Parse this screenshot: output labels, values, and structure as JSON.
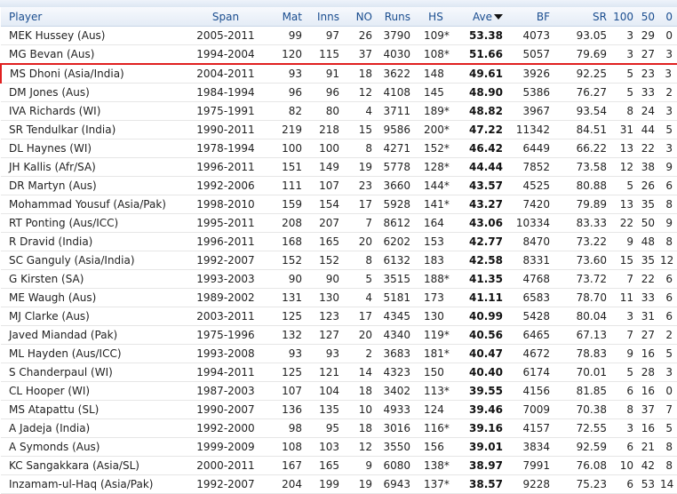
{
  "columns": {
    "player": "Player",
    "span": "Span",
    "mat": "Mat",
    "inns": "Inns",
    "no": "NO",
    "runs": "Runs",
    "hs": "HS",
    "ave": "Ave",
    "bf": "BF",
    "sr": "SR",
    "hundreds": "100",
    "fifties": "50",
    "ducks": "0"
  },
  "rows": [
    {
      "player": "MEK Hussey (Aus)",
      "span": "2005-2011",
      "mat": "99",
      "inns": "97",
      "no": "26",
      "runs": "3790",
      "hs": "109*",
      "ave": "53.38",
      "bf": "4073",
      "sr": "93.05",
      "hundreds": "3",
      "fifties": "29",
      "ducks": "0"
    },
    {
      "player": "MG Bevan (Aus)",
      "span": "1994-2004",
      "mat": "120",
      "inns": "115",
      "no": "37",
      "runs": "4030",
      "hs": "108*",
      "ave": "51.66",
      "bf": "5057",
      "sr": "79.69",
      "hundreds": "3",
      "fifties": "27",
      "ducks": "3"
    },
    {
      "player": "MS Dhoni (Asia/India)",
      "span": "2004-2011",
      "mat": "93",
      "inns": "91",
      "no": "18",
      "runs": "3622",
      "hs": "148",
      "ave": "49.61",
      "bf": "3926",
      "sr": "92.25",
      "hundreds": "5",
      "fifties": "23",
      "ducks": "3"
    },
    {
      "player": "DM Jones (Aus)",
      "span": "1984-1994",
      "mat": "96",
      "inns": "96",
      "no": "12",
      "runs": "4108",
      "hs": "145",
      "ave": "48.90",
      "bf": "5386",
      "sr": "76.27",
      "hundreds": "5",
      "fifties": "33",
      "ducks": "2"
    },
    {
      "player": "IVA Richards (WI)",
      "span": "1975-1991",
      "mat": "82",
      "inns": "80",
      "no": "4",
      "runs": "3711",
      "hs": "189*",
      "ave": "48.82",
      "bf": "3967",
      "sr": "93.54",
      "hundreds": "8",
      "fifties": "24",
      "ducks": "3"
    },
    {
      "player": "SR Tendulkar (India)",
      "span": "1990-2011",
      "mat": "219",
      "inns": "218",
      "no": "15",
      "runs": "9586",
      "hs": "200*",
      "ave": "47.22",
      "bf": "11342",
      "sr": "84.51",
      "hundreds": "31",
      "fifties": "44",
      "ducks": "5"
    },
    {
      "player": "DL Haynes (WI)",
      "span": "1978-1994",
      "mat": "100",
      "inns": "100",
      "no": "8",
      "runs": "4271",
      "hs": "152*",
      "ave": "46.42",
      "bf": "6449",
      "sr": "66.22",
      "hundreds": "13",
      "fifties": "22",
      "ducks": "3"
    },
    {
      "player": "JH Kallis (Afr/SA)",
      "span": "1996-2011",
      "mat": "151",
      "inns": "149",
      "no": "19",
      "runs": "5778",
      "hs": "128*",
      "ave": "44.44",
      "bf": "7852",
      "sr": "73.58",
      "hundreds": "12",
      "fifties": "38",
      "ducks": "9"
    },
    {
      "player": "DR Martyn (Aus)",
      "span": "1992-2006",
      "mat": "111",
      "inns": "107",
      "no": "23",
      "runs": "3660",
      "hs": "144*",
      "ave": "43.57",
      "bf": "4525",
      "sr": "80.88",
      "hundreds": "5",
      "fifties": "26",
      "ducks": "6"
    },
    {
      "player": "Mohammad Yousuf (Asia/Pak)",
      "span": "1998-2010",
      "mat": "159",
      "inns": "154",
      "no": "17",
      "runs": "5928",
      "hs": "141*",
      "ave": "43.27",
      "bf": "7420",
      "sr": "79.89",
      "hundreds": "13",
      "fifties": "35",
      "ducks": "8"
    },
    {
      "player": "RT Ponting (Aus/ICC)",
      "span": "1995-2011",
      "mat": "208",
      "inns": "207",
      "no": "7",
      "runs": "8612",
      "hs": "164",
      "ave": "43.06",
      "bf": "10334",
      "sr": "83.33",
      "hundreds": "22",
      "fifties": "50",
      "ducks": "9"
    },
    {
      "player": "R Dravid (India)",
      "span": "1996-2011",
      "mat": "168",
      "inns": "165",
      "no": "20",
      "runs": "6202",
      "hs": "153",
      "ave": "42.77",
      "bf": "8470",
      "sr": "73.22",
      "hundreds": "9",
      "fifties": "48",
      "ducks": "8"
    },
    {
      "player": "SC Ganguly (Asia/India)",
      "span": "1992-2007",
      "mat": "152",
      "inns": "152",
      "no": "8",
      "runs": "6132",
      "hs": "183",
      "ave": "42.58",
      "bf": "8331",
      "sr": "73.60",
      "hundreds": "15",
      "fifties": "35",
      "ducks": "12"
    },
    {
      "player": "G Kirsten (SA)",
      "span": "1993-2003",
      "mat": "90",
      "inns": "90",
      "no": "5",
      "runs": "3515",
      "hs": "188*",
      "ave": "41.35",
      "bf": "4768",
      "sr": "73.72",
      "hundreds": "7",
      "fifties": "22",
      "ducks": "6"
    },
    {
      "player": "ME Waugh (Aus)",
      "span": "1989-2002",
      "mat": "131",
      "inns": "130",
      "no": "4",
      "runs": "5181",
      "hs": "173",
      "ave": "41.11",
      "bf": "6583",
      "sr": "78.70",
      "hundreds": "11",
      "fifties": "33",
      "ducks": "6"
    },
    {
      "player": "MJ Clarke (Aus)",
      "span": "2003-2011",
      "mat": "125",
      "inns": "123",
      "no": "17",
      "runs": "4345",
      "hs": "130",
      "ave": "40.99",
      "bf": "5428",
      "sr": "80.04",
      "hundreds": "3",
      "fifties": "31",
      "ducks": "6"
    },
    {
      "player": "Javed Miandad (Pak)",
      "span": "1975-1996",
      "mat": "132",
      "inns": "127",
      "no": "20",
      "runs": "4340",
      "hs": "119*",
      "ave": "40.56",
      "bf": "6465",
      "sr": "67.13",
      "hundreds": "7",
      "fifties": "27",
      "ducks": "2"
    },
    {
      "player": "ML Hayden (Aus/ICC)",
      "span": "1993-2008",
      "mat": "93",
      "inns": "93",
      "no": "2",
      "runs": "3683",
      "hs": "181*",
      "ave": "40.47",
      "bf": "4672",
      "sr": "78.83",
      "hundreds": "9",
      "fifties": "16",
      "ducks": "5"
    },
    {
      "player": "S Chanderpaul (WI)",
      "span": "1994-2011",
      "mat": "125",
      "inns": "121",
      "no": "14",
      "runs": "4323",
      "hs": "150",
      "ave": "40.40",
      "bf": "6174",
      "sr": "70.01",
      "hundreds": "5",
      "fifties": "28",
      "ducks": "3"
    },
    {
      "player": "CL Hooper (WI)",
      "span": "1987-2003",
      "mat": "107",
      "inns": "104",
      "no": "18",
      "runs": "3402",
      "hs": "113*",
      "ave": "39.55",
      "bf": "4156",
      "sr": "81.85",
      "hundreds": "6",
      "fifties": "16",
      "ducks": "0"
    },
    {
      "player": "MS Atapattu (SL)",
      "span": "1990-2007",
      "mat": "136",
      "inns": "135",
      "no": "10",
      "runs": "4933",
      "hs": "124",
      "ave": "39.46",
      "bf": "7009",
      "sr": "70.38",
      "hundreds": "8",
      "fifties": "37",
      "ducks": "7"
    },
    {
      "player": "A Jadeja (India)",
      "span": "1992-2000",
      "mat": "98",
      "inns": "95",
      "no": "18",
      "runs": "3016",
      "hs": "116*",
      "ave": "39.16",
      "bf": "4157",
      "sr": "72.55",
      "hundreds": "3",
      "fifties": "16",
      "ducks": "5"
    },
    {
      "player": "A Symonds (Aus)",
      "span": "1999-2009",
      "mat": "108",
      "inns": "103",
      "no": "12",
      "runs": "3550",
      "hs": "156",
      "ave": "39.01",
      "bf": "3834",
      "sr": "92.59",
      "hundreds": "6",
      "fifties": "21",
      "ducks": "8"
    },
    {
      "player": "KC Sangakkara (Asia/SL)",
      "span": "2000-2011",
      "mat": "167",
      "inns": "165",
      "no": "9",
      "runs": "6080",
      "hs": "138*",
      "ave": "38.97",
      "bf": "7991",
      "sr": "76.08",
      "hundreds": "10",
      "fifties": "42",
      "ducks": "8"
    },
    {
      "player": "Inzamam-ul-Haq (Asia/Pak)",
      "span": "1992-2007",
      "mat": "204",
      "inns": "199",
      "no": "19",
      "runs": "6943",
      "hs": "137*",
      "ave": "38.57",
      "bf": "9228",
      "sr": "75.23",
      "hundreds": "6",
      "fifties": "53",
      "ducks": "14"
    }
  ],
  "highlighted_row_index": 2,
  "colors": {
    "header_text": "#1a4d8f",
    "highlight_border": "#e02020",
    "go_icon": "#2f79c9"
  },
  "icons": {
    "row_action": "go-arrow-icon",
    "sort": "sort-desc-icon"
  }
}
